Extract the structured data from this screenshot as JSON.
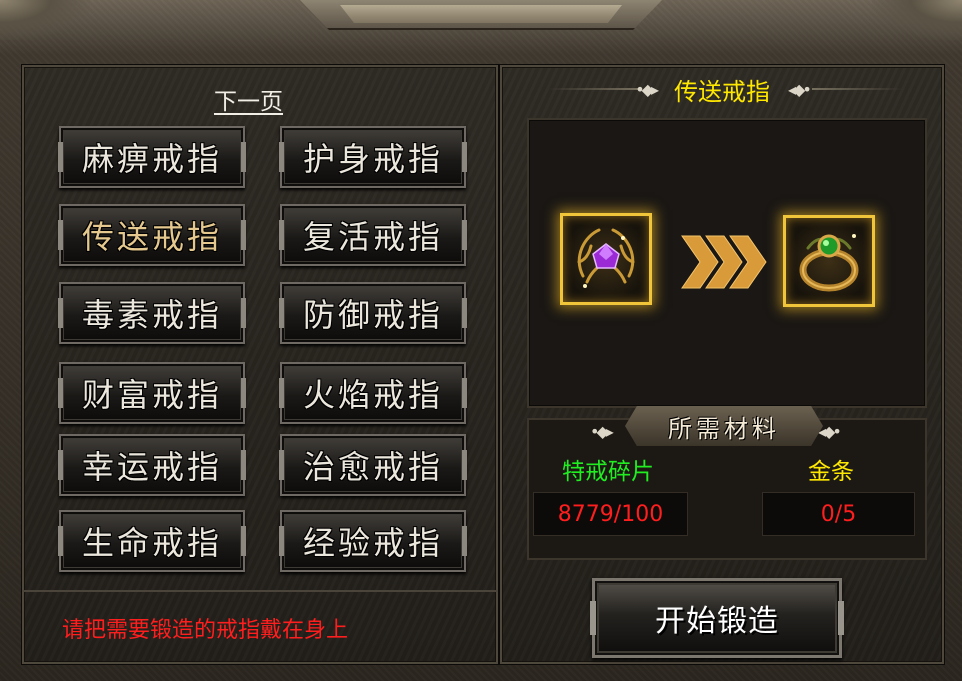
{
  "left_panel": {
    "next_page_label": "下一页",
    "rings": [
      {
        "label": "麻痹戒指",
        "selected": false
      },
      {
        "label": "护身戒指",
        "selected": false
      },
      {
        "label": "传送戒指",
        "selected": true
      },
      {
        "label": "复活戒指",
        "selected": false
      },
      {
        "label": "毒素戒指",
        "selected": false
      },
      {
        "label": "防御戒指",
        "selected": false
      },
      {
        "label": "财富戒指",
        "selected": false
      },
      {
        "label": "火焰戒指",
        "selected": false
      },
      {
        "label": "幸运戒指",
        "selected": false
      },
      {
        "label": "治愈戒指",
        "selected": false
      },
      {
        "label": "生命戒指",
        "selected": false
      },
      {
        "label": "经验戒指",
        "selected": false
      }
    ],
    "hint": "请把需要锻造的戒指戴在身上"
  },
  "right_panel": {
    "target_title": "传送戒指",
    "materials_header": "所需材料",
    "materials": [
      {
        "name": "特戒碎片",
        "value": "8779/100",
        "name_color": "#20ee20"
      },
      {
        "name": "金条",
        "value": "0/5",
        "name_color": "#ffe800"
      }
    ],
    "forge_button": "开始锻造",
    "source_item_icon": "purple-gem-fragment-icon",
    "result_item_icon": "green-gem-ring-icon"
  },
  "colors": {
    "title_yellow": "#ffe800",
    "warning_red": "#ff1e1e",
    "glow_gold": "#f0c53a"
  }
}
